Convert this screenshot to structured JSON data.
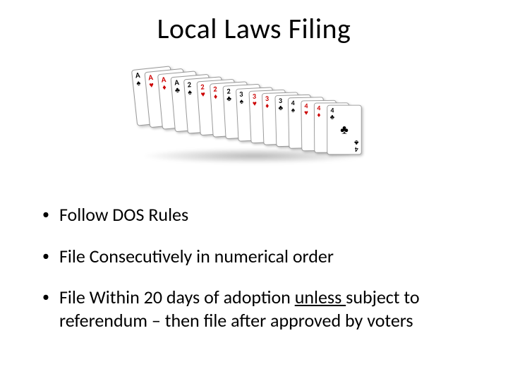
{
  "title": "Local Laws Filing",
  "bullets": [
    {
      "text": "Follow DOS Rules"
    },
    {
      "text": "File Consecutively in numerical order"
    },
    {
      "text_pre": "File Within 20 days of adoption ",
      "underline": "unless ",
      "text_post": "subject to referendum – then file after approved by voters"
    }
  ],
  "cards": [
    {
      "rank": "A",
      "suit": "♠",
      "color": "black"
    },
    {
      "rank": "A",
      "suit": "♥",
      "color": "red"
    },
    {
      "rank": "A",
      "suit": "♦",
      "color": "red"
    },
    {
      "rank": "A",
      "suit": "♣",
      "color": "black"
    },
    {
      "rank": "2",
      "suit": "♠",
      "color": "black"
    },
    {
      "rank": "2",
      "suit": "♥",
      "color": "red"
    },
    {
      "rank": "2",
      "suit": "♦",
      "color": "red"
    },
    {
      "rank": "2",
      "suit": "♣",
      "color": "black"
    },
    {
      "rank": "3",
      "suit": "♠",
      "color": "black"
    },
    {
      "rank": "3",
      "suit": "♥",
      "color": "red"
    },
    {
      "rank": "3",
      "suit": "♦",
      "color": "red"
    },
    {
      "rank": "3",
      "suit": "♣",
      "color": "black"
    },
    {
      "rank": "4",
      "suit": "♠",
      "color": "black"
    },
    {
      "rank": "4",
      "suit": "♥",
      "color": "red"
    },
    {
      "rank": "4",
      "suit": "♦",
      "color": "red"
    },
    {
      "rank": "4",
      "suit": "♣",
      "color": "black"
    }
  ]
}
